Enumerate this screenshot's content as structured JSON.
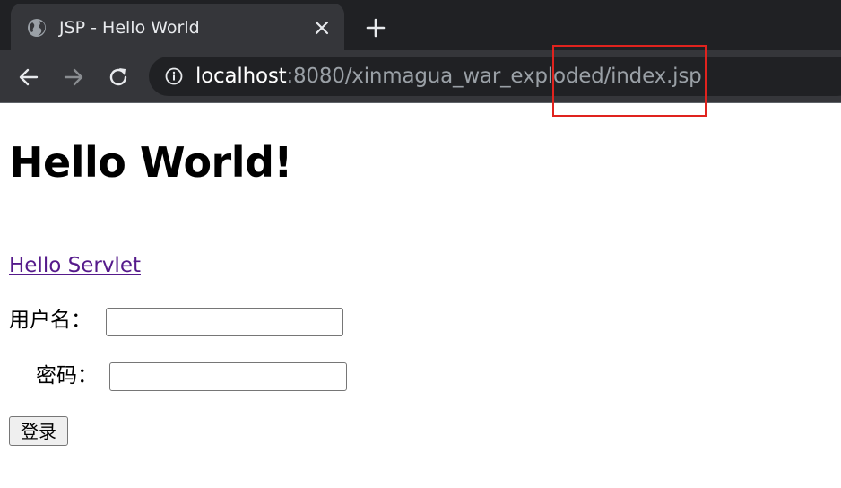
{
  "browser": {
    "tab": {
      "title": "JSP - Hello World",
      "favicon": "globe-icon",
      "close_icon": "close-icon"
    },
    "new_tab_icon": "plus-icon",
    "toolbar": {
      "back_icon": "arrow-left-icon",
      "forward_icon": "arrow-right-icon",
      "reload_icon": "reload-icon"
    },
    "omnibox": {
      "info_icon": "info-icon",
      "url_host": "localhost",
      "url_rest": ":8080/xinmagua_war_exploded/index.jsp"
    }
  },
  "annotation": {
    "color": "#e0231e"
  },
  "page": {
    "title": "Hello World!",
    "servlet_link": "Hello Servlet",
    "form": {
      "username_label": "用户名：",
      "username_value": "",
      "password_label": "密码：",
      "password_value": "",
      "submit_label": "登录"
    }
  },
  "colors": {
    "tabstrip_bg": "#202124",
    "toolbar_bg": "#35363a",
    "link": "#551a8b"
  }
}
